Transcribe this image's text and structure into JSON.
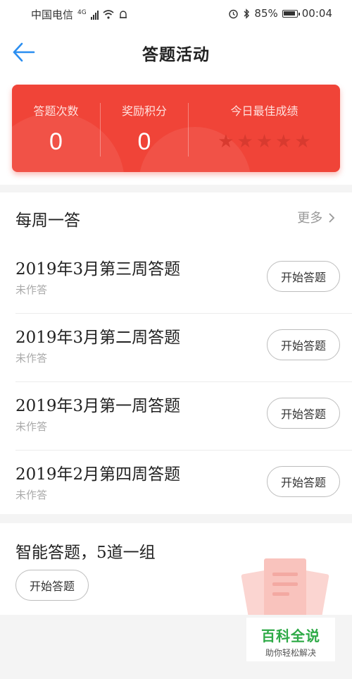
{
  "status_bar": {
    "carrier": "中国电信",
    "network": "4G",
    "battery": "85%",
    "time": "00:04",
    "icons": [
      "wifi-icon",
      "notification-icon",
      "alarm-icon",
      "bluetooth-icon",
      "battery-icon"
    ]
  },
  "header": {
    "title": "答题活动",
    "back_icon": "arrow-left-icon"
  },
  "stats": {
    "attempts_label": "答题次数",
    "attempts_value": "0",
    "points_label": "奖励积分",
    "points_value": "0",
    "best_label": "今日最佳成绩",
    "best_stars": 0,
    "max_stars": 5
  },
  "weekly": {
    "title": "每周一答",
    "more_label": "更多",
    "items": [
      {
        "title": "2019年3月第三周答题",
        "status": "未作答",
        "button": "开始答题"
      },
      {
        "title": "2019年3月第二周答题",
        "status": "未作答",
        "button": "开始答题"
      },
      {
        "title": "2019年3月第一周答题",
        "status": "未作答",
        "button": "开始答题"
      },
      {
        "title": "2019年2月第四周答题",
        "status": "未作答",
        "button": "开始答题"
      }
    ]
  },
  "smart": {
    "title": "智能答题，5道一组",
    "button": "开始答题"
  },
  "watermark": {
    "main": "百科全说",
    "sub": "助你轻松解决"
  },
  "colors": {
    "accent_red": "#f04438",
    "star_inactive": "#d83a2f",
    "back_blue": "#2b8ef0",
    "watermark_green": "#2eaa47"
  }
}
